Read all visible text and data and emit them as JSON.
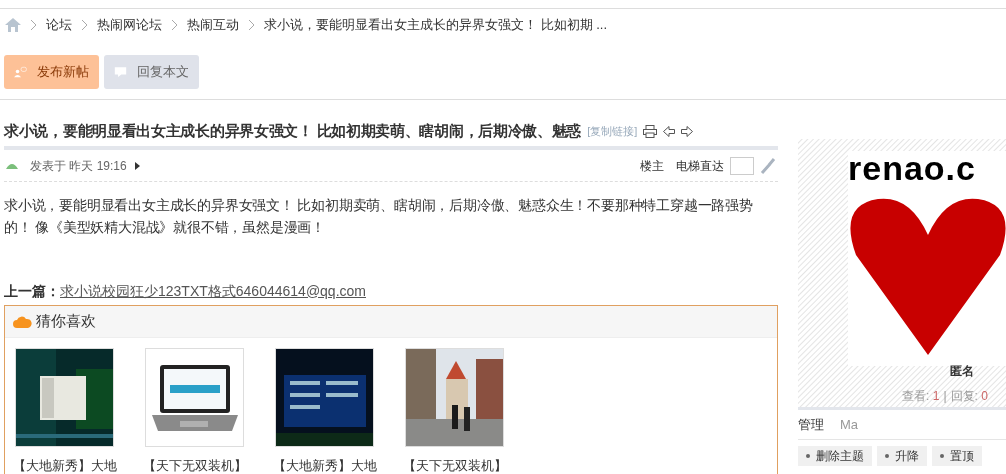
{
  "breadcrumb": [
    "论坛",
    "热闹网论坛",
    "热闹互动",
    "求小说，要能明显看出女主成长的异界女强文！ 比如初期 ..."
  ],
  "actions": [
    {
      "label": "发布新帖",
      "kind": "primary"
    },
    {
      "label": "回复本文",
      "kind": "secondary"
    }
  ],
  "thread": {
    "title": "求小说，要能明显看出女主成长的异界女强文！ 比如初期卖萌、瞎胡闹，后期冷傲、魅惑",
    "copy_link": "[复制链接]",
    "meta": {
      "posted_label": "发表于",
      "time": "昨天 19:16",
      "author_only": "楼主",
      "jump_label": "电梯直达"
    },
    "body": "求小说，要能明显看出女主成长的异界女强文！ 比如初期卖萌、瞎胡闹，后期冷傲、魅惑众生！不要那种特工穿越一路强势的！ 像《美型妖精大混战》就很不错，虽然是漫画！",
    "previous": {
      "label": "上一篇：",
      "link": "求小说校园狂少123TXT格式646044614@qq.com"
    }
  },
  "recommend": {
    "title": "猜你喜欢",
    "items": [
      {
        "caption": "【大地新秀】大地"
      },
      {
        "caption": "【天下无双装机】"
      },
      {
        "caption": "【大地新秀】大地"
      },
      {
        "caption": "【天下无双装机】"
      }
    ]
  },
  "sidebar": {
    "ad_text": "renao.c",
    "user": "匿名",
    "views_label": "查看:",
    "views": "1",
    "stat_divider": "|",
    "replies_label": "回复:",
    "replies": "0",
    "manage_tabs": [
      {
        "label": "管理",
        "selected": true
      },
      {
        "label": "Ma",
        "selected": false
      }
    ],
    "buttons": [
      "删除主题",
      "升降",
      "置顶"
    ]
  }
}
